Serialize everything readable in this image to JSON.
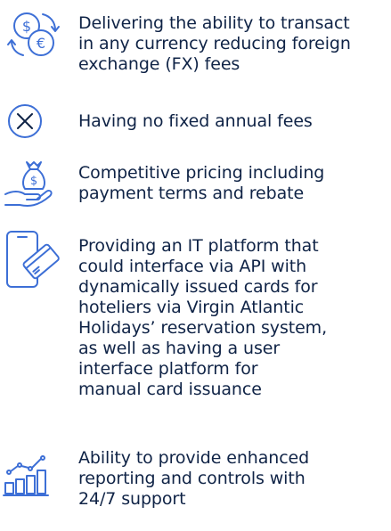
{
  "accent_color": "#3d6fd6",
  "text_color": "#0f2346",
  "items": [
    {
      "icon": "currency-exchange-icon",
      "text": "Delivering the ability to transact\nin any currency reducing foreign\nexchange (FX) fees"
    },
    {
      "icon": "no-fee-icon",
      "text": "Having no fixed annual fees"
    },
    {
      "icon": "money-bag-hand-icon",
      "text": "Competitive pricing including\npayment terms and rebate"
    },
    {
      "icon": "mobile-card-icon",
      "text": "Providing an IT platform that\ncould interface via API with\ndynamically issued cards for\nhoteliers via Virgin Atlantic\nHolidays’ reservation system,\nas well as having a user\ninterface platform for\nmanual card issuance"
    },
    {
      "icon": "growth-chart-icon",
      "text": "Ability to provide enhanced\nreporting and controls with\n24/7 support"
    }
  ]
}
